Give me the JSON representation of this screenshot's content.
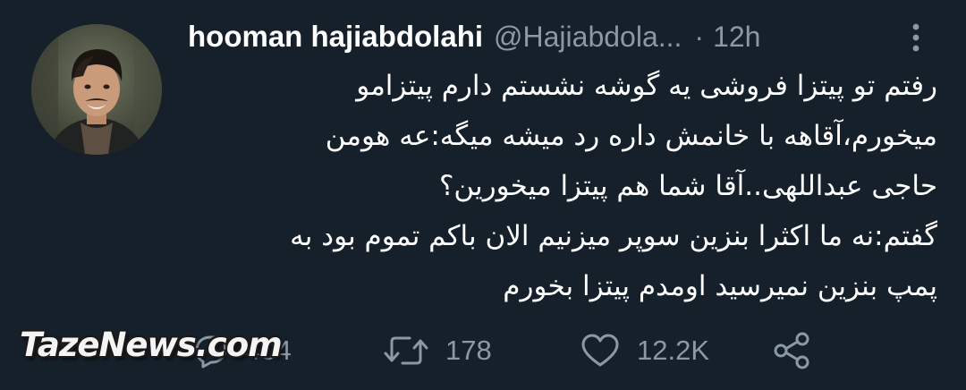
{
  "tweet": {
    "author": {
      "name": "hooman hajiabdolahi",
      "handle": "@Hajiabdola...",
      "separator": "·",
      "time": "12h"
    },
    "body_lines": [
      "رفتم تو پیتزا فروشی یه گوشه نشستم دارم پیتزامو",
      "میخورم،آقاهه با خانمش داره رد میشه میگه:عه هومن",
      "حاجی عبداللهی..آقا شما هم پیتزا میخورین؟",
      "گفتم:نه ما اکثرا بنزین سوپر میزنیم الان باکم تموم بود به",
      "پمپ بنزین نمیرسید اومدم پیتزا بخورم"
    ],
    "actions": {
      "reply": {
        "icon": "reply-icon",
        "count": "404"
      },
      "retweet": {
        "icon": "retweet-icon",
        "count": "178"
      },
      "like": {
        "icon": "heart-icon",
        "count": "12.2K"
      },
      "share": {
        "icon": "share-icon"
      }
    },
    "more_icon": "more-vertical-icon"
  },
  "watermark": "TazeNews.com",
  "colors": {
    "background": "#16202b",
    "text_primary": "#ffffff",
    "text_secondary": "#8b98a5"
  }
}
